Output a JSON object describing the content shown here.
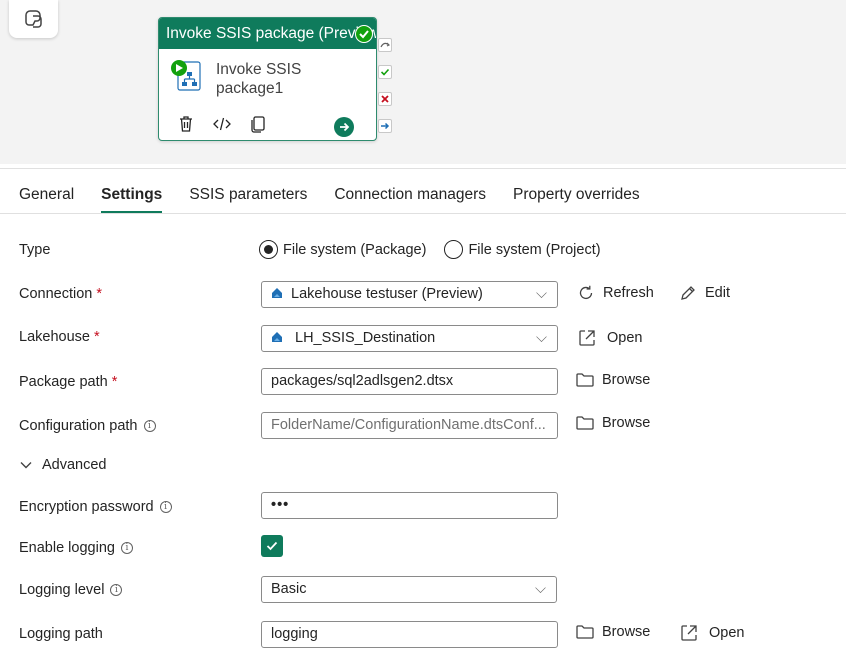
{
  "canvas": {
    "activity": {
      "header": "Invoke SSIS package (Preview)",
      "name": "Invoke SSIS package1"
    }
  },
  "tabs": [
    {
      "label": "General"
    },
    {
      "label": "Settings",
      "active": true
    },
    {
      "label": "SSIS parameters"
    },
    {
      "label": "Connection managers"
    },
    {
      "label": "Property overrides"
    }
  ],
  "settings": {
    "type": {
      "label": "Type",
      "options": [
        "File system (Package)",
        "File system (Project)"
      ],
      "selected": "File system (Package)"
    },
    "connection": {
      "label": "Connection",
      "value": "Lakehouse testuser (Preview)",
      "refresh": "Refresh",
      "edit": "Edit"
    },
    "lakehouse": {
      "label": "Lakehouse",
      "value": "LH_SSIS_Destination",
      "open": "Open"
    },
    "package_path": {
      "label": "Package path",
      "value": "packages/sql2adlsgen2.dtsx",
      "browse": "Browse"
    },
    "configuration_path": {
      "label": "Configuration path",
      "placeholder": "FolderName/ConfigurationName.dtsConf...",
      "browse": "Browse"
    },
    "advanced": {
      "label": "Advanced"
    },
    "encryption_password": {
      "label": "Encryption password",
      "value": "•••"
    },
    "enable_logging": {
      "label": "Enable logging",
      "checked": true
    },
    "logging_level": {
      "label": "Logging level",
      "value": "Basic"
    },
    "logging_path": {
      "label": "Logging path",
      "value": "logging",
      "browse": "Browse",
      "open": "Open"
    }
  },
  "colors": {
    "accent": "#0f7b5c",
    "required": "#c50f1f",
    "success": "#13a10e",
    "failure": "#c50f1f"
  }
}
